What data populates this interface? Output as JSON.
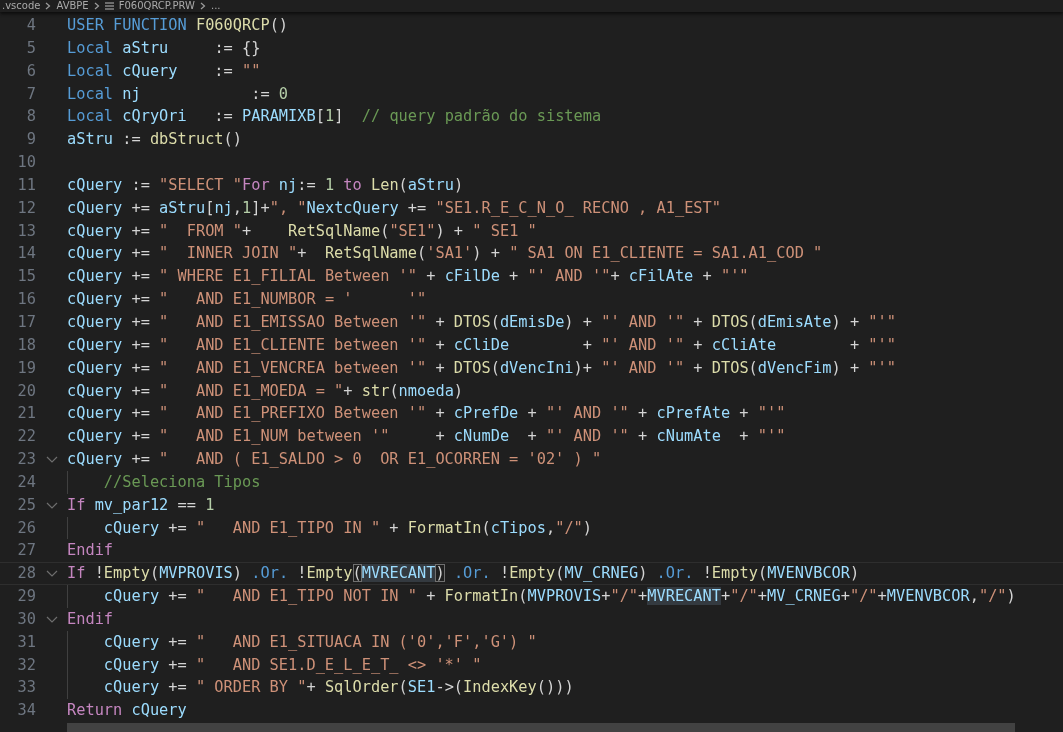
{
  "breadcrumb": [
    {
      "label": ".vscode",
      "kind": "folder"
    },
    {
      "label": "AVBPE",
      "kind": "folder"
    },
    {
      "label": "F060QRCP.PRW",
      "kind": "file"
    },
    {
      "label": "...",
      "kind": "more"
    }
  ],
  "lines": [
    {
      "number": "4",
      "tokens": [
        {
          "kind": "kw",
          "text": "USER FUNCTION "
        },
        {
          "kind": "fn",
          "text": "F060QRCP"
        },
        {
          "kind": "op",
          "text": "()"
        }
      ]
    },
    {
      "number": "5",
      "tokens": [
        {
          "kind": "kw",
          "text": "Local "
        },
        {
          "kind": "var",
          "text": "aStru"
        },
        {
          "kind": "op",
          "text": "     := {}"
        }
      ]
    },
    {
      "number": "6",
      "tokens": [
        {
          "kind": "kw",
          "text": "Local "
        },
        {
          "kind": "var",
          "text": "cQuery"
        },
        {
          "kind": "op",
          "text": "    := "
        },
        {
          "kind": "str",
          "text": "\"\""
        }
      ]
    },
    {
      "number": "7",
      "tokens": [
        {
          "kind": "kw",
          "text": "Local "
        },
        {
          "kind": "var",
          "text": "nj"
        },
        {
          "kind": "op",
          "text": "            := "
        },
        {
          "kind": "num",
          "text": "0"
        }
      ]
    },
    {
      "number": "8",
      "tokens": [
        {
          "kind": "kw",
          "text": "Local "
        },
        {
          "kind": "var",
          "text": "cQryOri"
        },
        {
          "kind": "op",
          "text": "   := "
        },
        {
          "kind": "var",
          "text": "PARAMIXB"
        },
        {
          "kind": "op",
          "text": "["
        },
        {
          "kind": "num",
          "text": "1"
        },
        {
          "kind": "op",
          "text": "]  "
        },
        {
          "kind": "cm",
          "text": "// query padrão do sistema"
        }
      ]
    },
    {
      "number": "9",
      "tokens": [
        {
          "kind": "var",
          "text": "aStru"
        },
        {
          "kind": "op",
          "text": " := "
        },
        {
          "kind": "fn",
          "text": "dbStruct"
        },
        {
          "kind": "op",
          "text": "()"
        }
      ]
    },
    {
      "number": "10"
    },
    {
      "number": "11",
      "tokens": [
        {
          "kind": "var",
          "text": "cQuery"
        },
        {
          "kind": "op",
          "text": " := "
        },
        {
          "kind": "str",
          "text": "\"SELECT \""
        },
        {
          "kind": "ctrl",
          "text": "For "
        },
        {
          "kind": "var",
          "text": "nj"
        },
        {
          "kind": "op",
          "text": ":= "
        },
        {
          "kind": "num",
          "text": "1"
        },
        {
          "kind": "ctrl",
          "text": " to "
        },
        {
          "kind": "fn",
          "text": "Len"
        },
        {
          "kind": "op",
          "text": "("
        },
        {
          "kind": "var",
          "text": "aStru"
        },
        {
          "kind": "op",
          "text": ")"
        }
      ]
    },
    {
      "number": "12",
      "tokens": [
        {
          "kind": "var",
          "text": "cQuery"
        },
        {
          "kind": "op",
          "text": " += "
        },
        {
          "kind": "var",
          "text": "aStru"
        },
        {
          "kind": "op",
          "text": "["
        },
        {
          "kind": "var",
          "text": "nj"
        },
        {
          "kind": "op",
          "text": ","
        },
        {
          "kind": "num",
          "text": "1"
        },
        {
          "kind": "op",
          "text": "]+"
        },
        {
          "kind": "str",
          "text": "\", \""
        },
        {
          "kind": "var",
          "text": "NextcQuery"
        },
        {
          "kind": "op",
          "text": " += "
        },
        {
          "kind": "str",
          "text": "\"SE1.R_E_C_N_O_ RECNO , A1_EST\""
        }
      ]
    },
    {
      "number": "13",
      "tokens": [
        {
          "kind": "var",
          "text": "cQuery"
        },
        {
          "kind": "op",
          "text": " += "
        },
        {
          "kind": "str",
          "text": "\"  FROM \""
        },
        {
          "kind": "op",
          "text": "+    "
        },
        {
          "kind": "fn",
          "text": "RetSqlName"
        },
        {
          "kind": "op",
          "text": "("
        },
        {
          "kind": "str",
          "text": "\"SE1\""
        },
        {
          "kind": "op",
          "text": ") + "
        },
        {
          "kind": "str",
          "text": "\" SE1 \""
        }
      ]
    },
    {
      "number": "14",
      "tokens": [
        {
          "kind": "var",
          "text": "cQuery"
        },
        {
          "kind": "op",
          "text": " += "
        },
        {
          "kind": "str",
          "text": "\"  INNER JOIN \""
        },
        {
          "kind": "op",
          "text": "+  "
        },
        {
          "kind": "fn",
          "text": "RetSqlName"
        },
        {
          "kind": "op",
          "text": "("
        },
        {
          "kind": "str",
          "text": "'SA1'"
        },
        {
          "kind": "op",
          "text": ") + "
        },
        {
          "kind": "str",
          "text": "\" SA1 ON E1_CLIENTE = SA1.A1_COD \""
        }
      ]
    },
    {
      "number": "15",
      "tokens": [
        {
          "kind": "var",
          "text": "cQuery"
        },
        {
          "kind": "op",
          "text": " += "
        },
        {
          "kind": "str",
          "text": "\" WHERE E1_FILIAL Between '\""
        },
        {
          "kind": "op",
          "text": " + "
        },
        {
          "kind": "var",
          "text": "cFilDe"
        },
        {
          "kind": "op",
          "text": " + "
        },
        {
          "kind": "str",
          "text": "\"' AND '\""
        },
        {
          "kind": "op",
          "text": "+ "
        },
        {
          "kind": "var",
          "text": "cFilAte"
        },
        {
          "kind": "op",
          "text": " + "
        },
        {
          "kind": "str",
          "text": "\"'\""
        }
      ]
    },
    {
      "number": "16",
      "tokens": [
        {
          "kind": "var",
          "text": "cQuery"
        },
        {
          "kind": "op",
          "text": " += "
        },
        {
          "kind": "str",
          "text": "\"   AND E1_NUMBOR = '      '\""
        }
      ]
    },
    {
      "number": "17",
      "tokens": [
        {
          "kind": "var",
          "text": "cQuery"
        },
        {
          "kind": "op",
          "text": " += "
        },
        {
          "kind": "str",
          "text": "\"   AND E1_EMISSAO Between '\""
        },
        {
          "kind": "op",
          "text": " + "
        },
        {
          "kind": "fn",
          "text": "DTOS"
        },
        {
          "kind": "op",
          "text": "("
        },
        {
          "kind": "var",
          "text": "dEmisDe"
        },
        {
          "kind": "op",
          "text": ") + "
        },
        {
          "kind": "str",
          "text": "\"' AND '\""
        },
        {
          "kind": "op",
          "text": " + "
        },
        {
          "kind": "fn",
          "text": "DTOS"
        },
        {
          "kind": "op",
          "text": "("
        },
        {
          "kind": "var",
          "text": "dEmisAte"
        },
        {
          "kind": "op",
          "text": ") + "
        },
        {
          "kind": "str",
          "text": "\"'\""
        }
      ]
    },
    {
      "number": "18",
      "tokens": [
        {
          "kind": "var",
          "text": "cQuery"
        },
        {
          "kind": "op",
          "text": " += "
        },
        {
          "kind": "str",
          "text": "\"   AND E1_CLIENTE between '\""
        },
        {
          "kind": "op",
          "text": " + "
        },
        {
          "kind": "var",
          "text": "cCliDe"
        },
        {
          "kind": "op",
          "text": "        + "
        },
        {
          "kind": "str",
          "text": "\"' AND '\""
        },
        {
          "kind": "op",
          "text": " + "
        },
        {
          "kind": "var",
          "text": "cCliAte"
        },
        {
          "kind": "op",
          "text": "        + "
        },
        {
          "kind": "str",
          "text": "\"'\""
        }
      ]
    },
    {
      "number": "19",
      "tokens": [
        {
          "kind": "var",
          "text": "cQuery"
        },
        {
          "kind": "op",
          "text": " += "
        },
        {
          "kind": "str",
          "text": "\"   AND E1_VENCREA between '\""
        },
        {
          "kind": "op",
          "text": " + "
        },
        {
          "kind": "fn",
          "text": "DTOS"
        },
        {
          "kind": "op",
          "text": "("
        },
        {
          "kind": "var",
          "text": "dVencIni"
        },
        {
          "kind": "op",
          "text": ")+ "
        },
        {
          "kind": "str",
          "text": "\"' AND '\""
        },
        {
          "kind": "op",
          "text": " + "
        },
        {
          "kind": "fn",
          "text": "DTOS"
        },
        {
          "kind": "op",
          "text": "("
        },
        {
          "kind": "var",
          "text": "dVencFim"
        },
        {
          "kind": "op",
          "text": ") + "
        },
        {
          "kind": "str",
          "text": "\"'\""
        }
      ]
    },
    {
      "number": "20",
      "tokens": [
        {
          "kind": "var",
          "text": "cQuery"
        },
        {
          "kind": "op",
          "text": " += "
        },
        {
          "kind": "str",
          "text": "\"   AND E1_MOEDA = \""
        },
        {
          "kind": "op",
          "text": "+ "
        },
        {
          "kind": "fn",
          "text": "str"
        },
        {
          "kind": "op",
          "text": "("
        },
        {
          "kind": "var",
          "text": "nmoeda"
        },
        {
          "kind": "op",
          "text": ")"
        }
      ]
    },
    {
      "number": "21",
      "tokens": [
        {
          "kind": "var",
          "text": "cQuery"
        },
        {
          "kind": "op",
          "text": " += "
        },
        {
          "kind": "str",
          "text": "\"   AND E1_PREFIXO Between '\""
        },
        {
          "kind": "op",
          "text": " + "
        },
        {
          "kind": "var",
          "text": "cPrefDe"
        },
        {
          "kind": "op",
          "text": " + "
        },
        {
          "kind": "str",
          "text": "\"' AND '\""
        },
        {
          "kind": "op",
          "text": " + "
        },
        {
          "kind": "var",
          "text": "cPrefAte"
        },
        {
          "kind": "op",
          "text": " + "
        },
        {
          "kind": "str",
          "text": "\"'\""
        }
      ]
    },
    {
      "number": "22",
      "tokens": [
        {
          "kind": "var",
          "text": "cQuery"
        },
        {
          "kind": "op",
          "text": " += "
        },
        {
          "kind": "str",
          "text": "\"   AND E1_NUM between '\""
        },
        {
          "kind": "op",
          "text": "     + "
        },
        {
          "kind": "var",
          "text": "cNumDe"
        },
        {
          "kind": "op",
          "text": "  + "
        },
        {
          "kind": "str",
          "text": "\"' AND '\""
        },
        {
          "kind": "op",
          "text": " + "
        },
        {
          "kind": "var",
          "text": "cNumAte"
        },
        {
          "kind": "op",
          "text": "  + "
        },
        {
          "kind": "str",
          "text": "\"'\""
        }
      ]
    },
    {
      "number": "23",
      "foldable": true,
      "tokens": [
        {
          "kind": "var",
          "text": "cQuery"
        },
        {
          "kind": "op",
          "text": " += "
        },
        {
          "kind": "str",
          "text": "\"   AND ( E1_SALDO > 0  OR E1_OCORREN = '02' ) \""
        }
      ]
    },
    {
      "number": "24",
      "guide": true,
      "tokens": [
        {
          "kind": "cm",
          "text": "//Seleciona Tipos"
        }
      ]
    },
    {
      "number": "25",
      "foldable": true,
      "tokens": [
        {
          "kind": "ctrl",
          "text": "If "
        },
        {
          "kind": "var",
          "text": "mv_par12"
        },
        {
          "kind": "op",
          "text": " == "
        },
        {
          "kind": "num",
          "text": "1"
        }
      ]
    },
    {
      "number": "26",
      "guide": true,
      "tokens": [
        {
          "kind": "var",
          "text": "cQuery"
        },
        {
          "kind": "op",
          "text": " += "
        },
        {
          "kind": "str",
          "text": "\"   AND E1_TIPO IN \""
        },
        {
          "kind": "op",
          "text": " + "
        },
        {
          "kind": "fn",
          "text": "FormatIn"
        },
        {
          "kind": "op",
          "text": "("
        },
        {
          "kind": "var",
          "text": "cTipos"
        },
        {
          "kind": "op",
          "text": ","
        },
        {
          "kind": "str",
          "text": "\"/\""
        },
        {
          "kind": "op",
          "text": ")"
        }
      ]
    },
    {
      "number": "27",
      "tokens": [
        {
          "kind": "ctrl",
          "text": "Endif"
        }
      ]
    },
    {
      "number": "28",
      "foldable": true,
      "current": true,
      "tokens": [
        {
          "kind": "ctrl",
          "text": "If "
        },
        {
          "kind": "op",
          "text": "!"
        },
        {
          "kind": "fn",
          "text": "Empty"
        },
        {
          "kind": "op",
          "text": "("
        },
        {
          "kind": "var",
          "text": "MVPROVIS"
        },
        {
          "kind": "op",
          "text": ") "
        },
        {
          "kind": "kw",
          "text": ".Or."
        },
        {
          "kind": "op",
          "text": " !"
        },
        {
          "kind": "fn",
          "text": "Empty"
        },
        {
          "kind": "op",
          "text": "(",
          "bracket_match": true
        },
        {
          "kind": "var",
          "text": "MVRECANT",
          "highlight": true
        },
        {
          "kind": "op",
          "text": ")",
          "bracket_match": true
        },
        {
          "kind": "kw",
          "text": " .Or."
        },
        {
          "kind": "op",
          "text": " !"
        },
        {
          "kind": "fn",
          "text": "Empty"
        },
        {
          "kind": "op",
          "text": "("
        },
        {
          "kind": "var",
          "text": "MV_CRNEG"
        },
        {
          "kind": "op",
          "text": ") "
        },
        {
          "kind": "kw",
          "text": ".Or."
        },
        {
          "kind": "op",
          "text": " !"
        },
        {
          "kind": "fn",
          "text": "Empty"
        },
        {
          "kind": "op",
          "text": "("
        },
        {
          "kind": "var",
          "text": "MVENVBCOR"
        },
        {
          "kind": "op",
          "text": ")"
        }
      ]
    },
    {
      "number": "29",
      "guide": true,
      "tokens": [
        {
          "kind": "var",
          "text": "cQuery"
        },
        {
          "kind": "op",
          "text": " += "
        },
        {
          "kind": "str",
          "text": "\"   AND E1_TIPO NOT IN \""
        },
        {
          "kind": "op",
          "text": " + "
        },
        {
          "kind": "fn",
          "text": "FormatIn"
        },
        {
          "kind": "op",
          "text": "("
        },
        {
          "kind": "var",
          "text": "MVPROVIS"
        },
        {
          "kind": "op",
          "text": "+"
        },
        {
          "kind": "str",
          "text": "\"/\""
        },
        {
          "kind": "op",
          "text": "+"
        },
        {
          "kind": "var",
          "text": "MVRECANT",
          "highlight": true
        },
        {
          "kind": "op",
          "text": "+"
        },
        {
          "kind": "str",
          "text": "\"/\""
        },
        {
          "kind": "op",
          "text": "+"
        },
        {
          "kind": "var",
          "text": "MV_CRNEG"
        },
        {
          "kind": "op",
          "text": "+"
        },
        {
          "kind": "str",
          "text": "\"/\""
        },
        {
          "kind": "op",
          "text": "+"
        },
        {
          "kind": "var",
          "text": "MVENVBCOR"
        },
        {
          "kind": "op",
          "text": ","
        },
        {
          "kind": "str",
          "text": "\"/\""
        },
        {
          "kind": "op",
          "text": ")"
        }
      ]
    },
    {
      "number": "30",
      "foldable": true,
      "tokens": [
        {
          "kind": "ctrl",
          "text": "Endif"
        }
      ]
    },
    {
      "number": "31",
      "guide": true,
      "tokens": [
        {
          "kind": "var",
          "text": "cQuery"
        },
        {
          "kind": "op",
          "text": " += "
        },
        {
          "kind": "str",
          "text": "\"   AND E1_SITUACA IN ('0','F','G') \""
        }
      ]
    },
    {
      "number": "32",
      "guide": true,
      "tokens": [
        {
          "kind": "var",
          "text": "cQuery"
        },
        {
          "kind": "op",
          "text": " += "
        },
        {
          "kind": "str",
          "text": "\"   AND SE1.D_E_L_E_T_ <> '*' \""
        }
      ]
    },
    {
      "number": "33",
      "guide": true,
      "tokens": [
        {
          "kind": "var",
          "text": "cQuery"
        },
        {
          "kind": "op",
          "text": " += "
        },
        {
          "kind": "str",
          "text": "\" ORDER BY \""
        },
        {
          "kind": "op",
          "text": "+ "
        },
        {
          "kind": "fn",
          "text": "SqlOrder"
        },
        {
          "kind": "op",
          "text": "("
        },
        {
          "kind": "var",
          "text": "SE1"
        },
        {
          "kind": "op",
          "text": "->("
        },
        {
          "kind": "fn",
          "text": "IndexKey"
        },
        {
          "kind": "op",
          "text": "()))"
        }
      ]
    },
    {
      "number": "34",
      "tokens": [
        {
          "kind": "ctrl",
          "text": "Return "
        },
        {
          "kind": "var",
          "text": "cQuery"
        }
      ]
    }
  ]
}
